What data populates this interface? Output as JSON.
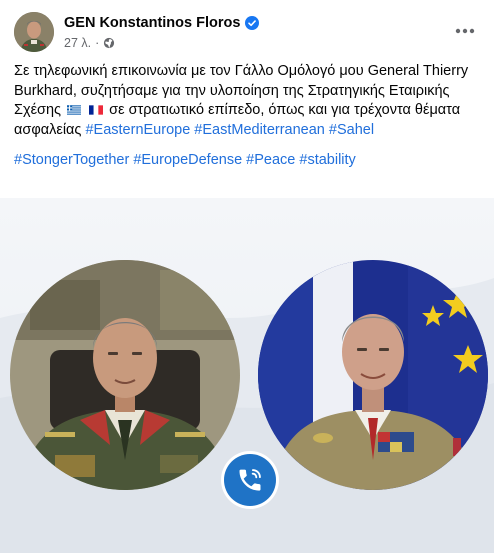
{
  "post": {
    "author": "GEN Konstantinos Floros",
    "timestamp": "27 λ.",
    "audience_icon": "globe-icon",
    "verified_icon": "verified-badge-icon",
    "more_icon": "more-options-icon",
    "message_before_flags": "Σε τηλεφωνική επικοινωνία με τον Γάλλο Ομόλογό μου General Thierry Burkhard, συζητήσαμε για την υλοποίηση της Στρατηγικής Εταιρικής Σχέσης",
    "flags": [
      "greek-flag-icon",
      "french-flag-icon"
    ],
    "message_after_flags": "σε στρατιωτικό επίπεδο, όπως και για τρέχοντα θέματα ασφαλείας",
    "hashtags_line1": [
      "#EasternEurope",
      "#EastMediterranean",
      "#Sahel"
    ],
    "hashtags_line2": [
      "#StongerTogether",
      "#EuropeDefense",
      "#Peace",
      "#stability"
    ]
  },
  "media": {
    "left_portrait": "greek-general-portrait",
    "right_portrait": "french-general-portrait",
    "call_icon": "phone-call-icon"
  },
  "colors": {
    "hashtag": "#216fdb",
    "verified": "#1877f2",
    "call_button": "#1f73c6",
    "secondary_text": "#65676b"
  }
}
